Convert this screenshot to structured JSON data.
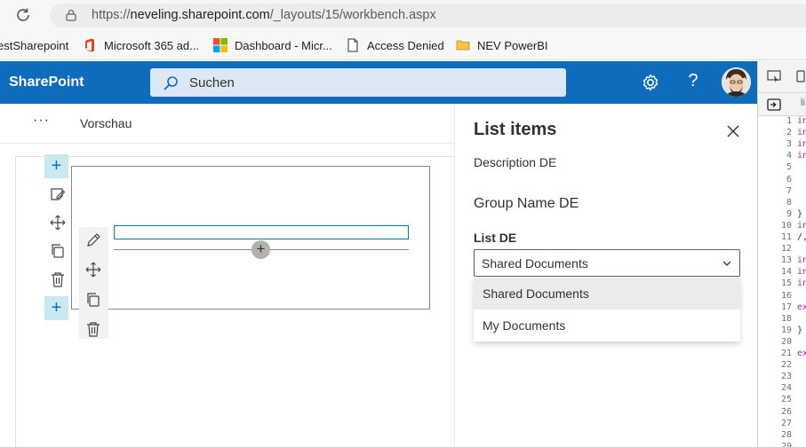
{
  "browser": {
    "url_prefix": "https://",
    "url_host": "neveling.sharepoint.com",
    "url_path": "/_layouts/15/workbench.aspx"
  },
  "bookmarks": [
    {
      "label": "estSharepoint",
      "icon": "none"
    },
    {
      "label": "Microsoft 365 ad...",
      "icon": "office-icon"
    },
    {
      "label": "Dashboard - Micr...",
      "icon": "microsoft-logo-icon"
    },
    {
      "label": "Access Denied",
      "icon": "page-icon"
    },
    {
      "label": "NEV PowerBI",
      "icon": "folder-icon"
    }
  ],
  "suite_bar": {
    "title": "SharePoint",
    "search_placeholder": "Suchen",
    "help_label": "?",
    "color": "#0f6cbd"
  },
  "command_bar": {
    "more_label": "···",
    "preview_label": "Vorschau"
  },
  "canvas": {
    "add_label": "+",
    "webpart_add_label": "+"
  },
  "property_pane": {
    "title": "List items",
    "description": "Description DE",
    "group_name": "Group Name DE",
    "list_label": "List DE",
    "selected_value": "Shared Documents",
    "options": [
      "Shared Documents",
      "My Documents"
    ]
  },
  "devtools": {
    "line_numbers": [
      "1",
      "2",
      "3",
      "4",
      "5",
      "6",
      "7",
      "8",
      "9",
      "10",
      "11",
      "12",
      "13",
      "14",
      "15",
      "16",
      "17",
      "18",
      "19",
      "20",
      "21",
      "22",
      "23",
      "24",
      "25",
      "26",
      "27",
      "28",
      "29"
    ],
    "code_fragments": [
      {
        "line": "1",
        "text": "in"
      },
      {
        "line": "2",
        "text": "in"
      },
      {
        "line": "3",
        "text": "in"
      },
      {
        "line": "4",
        "text": "in"
      },
      {
        "line": "9",
        "text": "}"
      },
      {
        "line": "10",
        "text": "in"
      },
      {
        "line": "11",
        "text": "/,"
      },
      {
        "line": "13",
        "text": "in"
      },
      {
        "line": "14",
        "text": "in"
      },
      {
        "line": "15",
        "text": "in"
      },
      {
        "line": "17",
        "text": "ex"
      },
      {
        "line": "19",
        "text": "}"
      },
      {
        "line": "21",
        "text": "ex"
      }
    ],
    "tab_label": "li"
  }
}
